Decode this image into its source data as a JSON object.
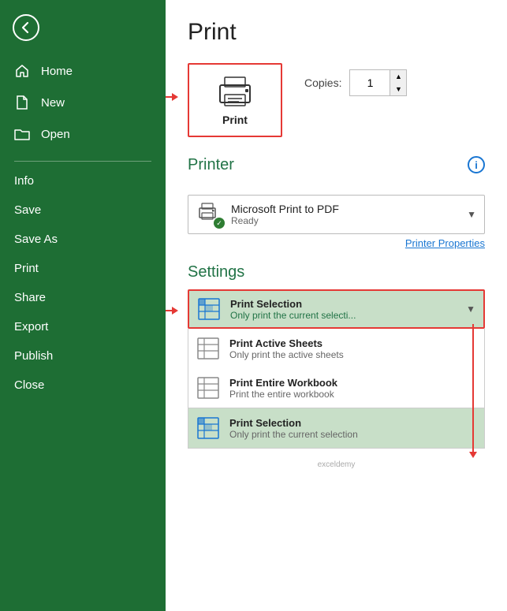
{
  "sidebar": {
    "back_label": "",
    "items_top": [
      {
        "id": "home",
        "label": "Home",
        "icon": "home"
      },
      {
        "id": "new",
        "label": "New",
        "icon": "new-file"
      },
      {
        "id": "open",
        "label": "Open",
        "icon": "folder"
      }
    ],
    "divider": true,
    "items_bottom": [
      {
        "id": "info",
        "label": "Info",
        "icon": ""
      },
      {
        "id": "save",
        "label": "Save",
        "icon": ""
      },
      {
        "id": "save-as",
        "label": "Save As",
        "icon": ""
      },
      {
        "id": "print",
        "label": "Print",
        "icon": "",
        "active": true
      },
      {
        "id": "share",
        "label": "Share",
        "icon": ""
      },
      {
        "id": "export",
        "label": "Export",
        "icon": ""
      },
      {
        "id": "publish",
        "label": "Publish",
        "icon": ""
      },
      {
        "id": "close",
        "label": "Close",
        "icon": ""
      }
    ]
  },
  "main": {
    "title": "Print",
    "print_button": {
      "label": "Print"
    },
    "copies": {
      "label": "Copies:",
      "value": "1"
    },
    "printer_section": {
      "header": "Printer",
      "info_icon": "i",
      "selected": {
        "name": "Microsoft Print to PDF",
        "status": "Ready"
      },
      "properties_link": "Printer Properties"
    },
    "settings_section": {
      "header": "Settings",
      "selected_option": {
        "title": "Print Selection",
        "desc": "Only print the current selecti..."
      },
      "options": [
        {
          "id": "active-sheets",
          "title": "Print Active Sheets",
          "desc": "Only print the active sheets"
        },
        {
          "id": "entire-workbook",
          "title": "Print Entire Workbook",
          "desc": "Print the entire workbook"
        },
        {
          "id": "selection",
          "title": "Print Selection",
          "desc": "Only print the current selection",
          "highlighted": true
        }
      ]
    },
    "watermark": "exceldemy"
  }
}
